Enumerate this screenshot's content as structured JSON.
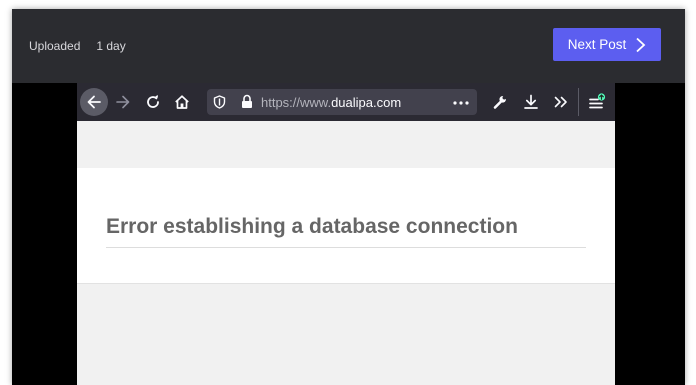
{
  "post": {
    "uploaded_label": "Uploaded",
    "uploaded_ago": "1 day",
    "next_post_label": "Next Post"
  },
  "browser": {
    "url_prefix": "https://www.",
    "url_host": "dualipa.com",
    "toolbar_icons": [
      "back-arrow-icon",
      "forward-arrow-icon",
      "reload-icon",
      "home-icon",
      "tracking-protection-shield-icon",
      "lock-icon",
      "page-actions-menu-icon",
      "wrench-icon",
      "download-icon",
      "overflow-chevrons-icon",
      "app-menu-icon"
    ]
  },
  "page": {
    "error_title": "Error establishing a database connection"
  },
  "colors": {
    "accent": "#5c5ef0",
    "topbar_bg": "#2b2c30",
    "browser_toolbar_bg": "#2b2a33",
    "urlbar_bg": "#42414d",
    "update_badge": "#54ffbd",
    "page_bg": "#f1f1f1",
    "heading_text": "#666666"
  }
}
